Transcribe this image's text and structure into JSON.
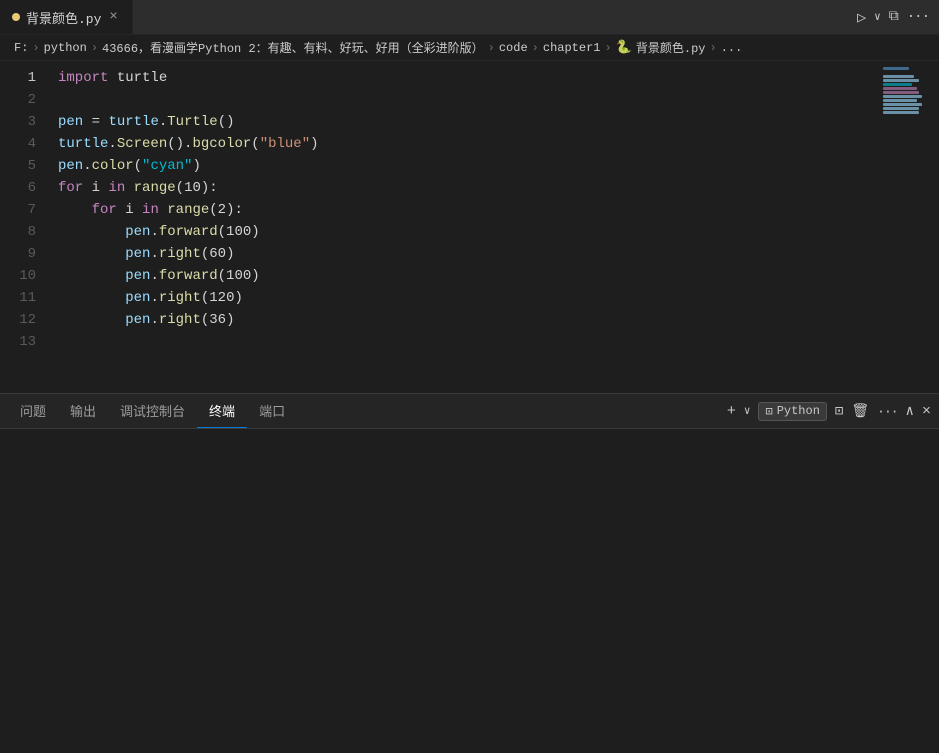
{
  "tab": {
    "icon_color": "#e8c975",
    "filename": "背景颜色.py",
    "close_label": "×"
  },
  "breadcrumb": {
    "items": [
      "F:",
      "python",
      "43666，看漫画学Python 2：有趣、有料、好玩、好用（全彩进阶版）",
      "code",
      "chapter1",
      "背景颜色.py",
      "..."
    ]
  },
  "toolbar_icons": {
    "run": "▷",
    "run_dropdown": "∨",
    "split": "⧉",
    "more": "···"
  },
  "code": {
    "lines": [
      {
        "num": 1,
        "tokens": [
          {
            "t": "import",
            "c": "kw"
          },
          {
            "t": " turtle",
            "c": "plain"
          }
        ]
      },
      {
        "num": 2,
        "tokens": []
      },
      {
        "num": 3,
        "tokens": [
          {
            "t": "pen",
            "c": "var"
          },
          {
            "t": " = ",
            "c": "plain"
          },
          {
            "t": "turtle",
            "c": "var"
          },
          {
            "t": ".",
            "c": "plain"
          },
          {
            "t": "Turtle",
            "c": "fn"
          },
          {
            "t": "()",
            "c": "plain"
          }
        ]
      },
      {
        "num": 4,
        "tokens": [
          {
            "t": "turtle",
            "c": "var"
          },
          {
            "t": ".",
            "c": "plain"
          },
          {
            "t": "Screen",
            "c": "fn"
          },
          {
            "t": "().",
            "c": "plain"
          },
          {
            "t": "bgcolor",
            "c": "fn"
          },
          {
            "t": "(",
            "c": "plain"
          },
          {
            "t": "\"blue\"",
            "c": "str"
          },
          {
            "t": ")",
            "c": "plain"
          }
        ]
      },
      {
        "num": 5,
        "tokens": [
          {
            "t": "pen",
            "c": "var"
          },
          {
            "t": ".",
            "c": "plain"
          },
          {
            "t": "color",
            "c": "fn"
          },
          {
            "t": "(",
            "c": "plain"
          },
          {
            "t": "\"cyan\"",
            "c": "cyan-str"
          },
          {
            "t": ")",
            "c": "plain"
          }
        ]
      },
      {
        "num": 6,
        "tokens": [
          {
            "t": "for",
            "c": "kw"
          },
          {
            "t": " i ",
            "c": "plain"
          },
          {
            "t": "in",
            "c": "kw"
          },
          {
            "t": " ",
            "c": "plain"
          },
          {
            "t": "range",
            "c": "fn"
          },
          {
            "t": "(10):",
            "c": "plain"
          }
        ]
      },
      {
        "num": 7,
        "tokens": [
          {
            "t": "    ",
            "c": "plain"
          },
          {
            "t": "for",
            "c": "kw"
          },
          {
            "t": " i ",
            "c": "plain"
          },
          {
            "t": "in",
            "c": "kw"
          },
          {
            "t": " ",
            "c": "plain"
          },
          {
            "t": "range",
            "c": "fn"
          },
          {
            "t": "(2):",
            "c": "plain"
          }
        ]
      },
      {
        "num": 8,
        "tokens": [
          {
            "t": "        ",
            "c": "plain"
          },
          {
            "t": "pen",
            "c": "var"
          },
          {
            "t": ".",
            "c": "plain"
          },
          {
            "t": "forward",
            "c": "fn"
          },
          {
            "t": "(100)",
            "c": "plain"
          }
        ]
      },
      {
        "num": 9,
        "tokens": [
          {
            "t": "        ",
            "c": "plain"
          },
          {
            "t": "pen",
            "c": "var"
          },
          {
            "t": ".",
            "c": "plain"
          },
          {
            "t": "right",
            "c": "fn"
          },
          {
            "t": "(60)",
            "c": "plain"
          }
        ]
      },
      {
        "num": 10,
        "tokens": [
          {
            "t": "        ",
            "c": "plain"
          },
          {
            "t": "pen",
            "c": "var"
          },
          {
            "t": ".",
            "c": "plain"
          },
          {
            "t": "forward",
            "c": "fn"
          },
          {
            "t": "(100)",
            "c": "plain"
          }
        ]
      },
      {
        "num": 11,
        "tokens": [
          {
            "t": "        ",
            "c": "plain"
          },
          {
            "t": "pen",
            "c": "var"
          },
          {
            "t": ".",
            "c": "plain"
          },
          {
            "t": "right",
            "c": "fn"
          },
          {
            "t": "(120)",
            "c": "plain"
          }
        ]
      },
      {
        "num": 12,
        "tokens": [
          {
            "t": "        ",
            "c": "plain"
          },
          {
            "t": "pen",
            "c": "var"
          },
          {
            "t": ".",
            "c": "plain"
          },
          {
            "t": "right",
            "c": "fn"
          },
          {
            "t": "(36)",
            "c": "plain"
          }
        ]
      },
      {
        "num": 13,
        "tokens": []
      }
    ]
  },
  "panel": {
    "tabs": [
      {
        "label": "问题",
        "active": false
      },
      {
        "label": "输出",
        "active": false
      },
      {
        "label": "调试控制台",
        "active": false
      },
      {
        "label": "终端",
        "active": true
      },
      {
        "label": "端口",
        "active": false
      }
    ],
    "actions": {
      "add": "+",
      "dropdown": "∨",
      "python_label": "Python",
      "split": "⊡",
      "delete": "🗑",
      "more": "···",
      "maximize": "∧",
      "close": "×"
    }
  }
}
